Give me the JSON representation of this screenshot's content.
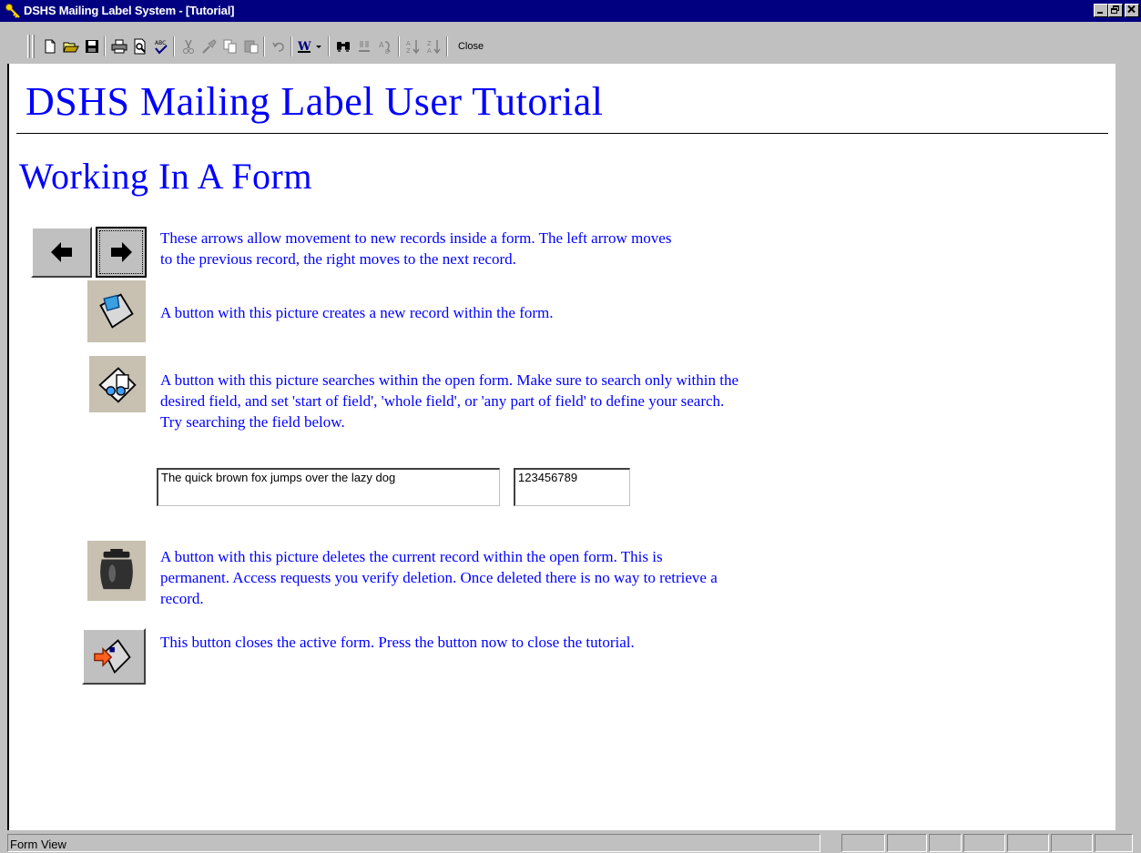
{
  "window": {
    "title": "DSHS Mailing Label System - [Tutorial]",
    "controls": [
      "minimize",
      "restore",
      "close"
    ]
  },
  "toolbar": {
    "icons": [
      "new-icon",
      "open-icon",
      "save-icon",
      "print-icon",
      "print-preview-icon",
      "spelling-icon",
      "cut-icon",
      "format-painter-icon",
      "copy-icon",
      "paste-icon",
      "undo-icon",
      "office-links-icon",
      "find-icon",
      "replace-icon",
      "goto-icon",
      "sort-ascending-icon",
      "sort-descending-icon"
    ],
    "close_label": "Close"
  },
  "document": {
    "heading": "DSHS Mailing Label User Tutorial",
    "section_title": "Working In A Form",
    "arrows_text_1": "These arrows allow movement to new records inside a form. The left arrow moves",
    "arrows_text_2": "to the previous record, the right moves to the next record.",
    "new_record_text": "A button with this picture creates a new record within the form.",
    "search_text_1": "A button with this picture searches within the open form.  Make sure to search only within the",
    "search_text_2": "desired field, and set 'start of field', 'whole field', or 'any part of field' to define your search.",
    "search_text_3": "Try searching the field below.",
    "field_text": "The quick brown fox jumps over the lazy dog",
    "field_number": "123456789",
    "delete_text_1": "A button with this picture deletes the current record within the open form.  This is",
    "delete_text_2": "permanent.  Access requests you verify deletion.  Once deleted there is no way to retrieve a",
    "delete_text_3": "record.",
    "close_text": "This button closes the active form.  Press the button now to close the tutorial."
  },
  "status": {
    "view": "Form View"
  },
  "colors": {
    "title_bar": "#000080",
    "doc_text": "#0000ff",
    "chrome": "#c0c0c0"
  }
}
